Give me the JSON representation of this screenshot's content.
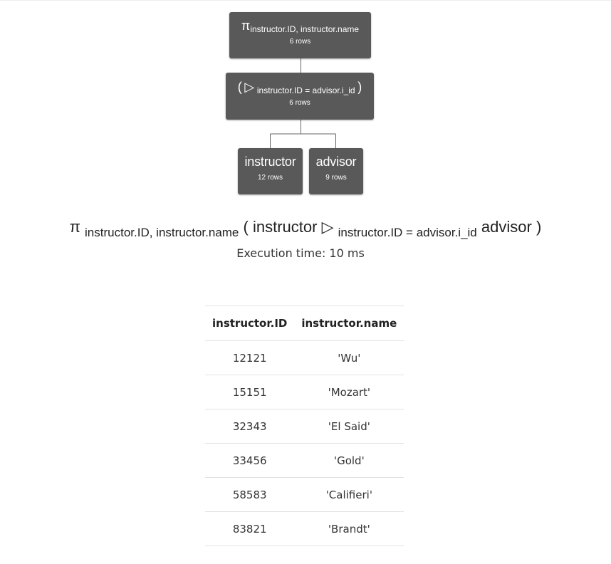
{
  "tree": {
    "projection": {
      "operator": "π",
      "attributes": "instructor.ID, instructor.name",
      "rows": "6 rows"
    },
    "join": {
      "open_paren": "(",
      "operator": "▷",
      "condition": "instructor.ID = advisor.i_id",
      "close_paren": ")",
      "rows": "6 rows"
    },
    "left_relation": {
      "name": "instructor",
      "rows": "12 rows"
    },
    "right_relation": {
      "name": "advisor",
      "rows": "9 rows"
    }
  },
  "expression": {
    "projection_symbol": "π",
    "projection_attributes": "instructor.ID, instructor.name",
    "open_paren": "(",
    "left_relation": "instructor",
    "join_symbol": "▷",
    "join_condition": "instructor.ID = advisor.i_id",
    "right_relation": "advisor",
    "close_paren": ")"
  },
  "execution_time": "Execution time: 10 ms",
  "result": {
    "columns": [
      "instructor.ID",
      "instructor.name"
    ],
    "rows": [
      [
        "12121",
        "'Wu'"
      ],
      [
        "15151",
        "'Mozart'"
      ],
      [
        "32343",
        "'El Said'"
      ],
      [
        "33456",
        "'Gold'"
      ],
      [
        "58583",
        "'Califieri'"
      ],
      [
        "83821",
        "'Brandt'"
      ]
    ]
  }
}
